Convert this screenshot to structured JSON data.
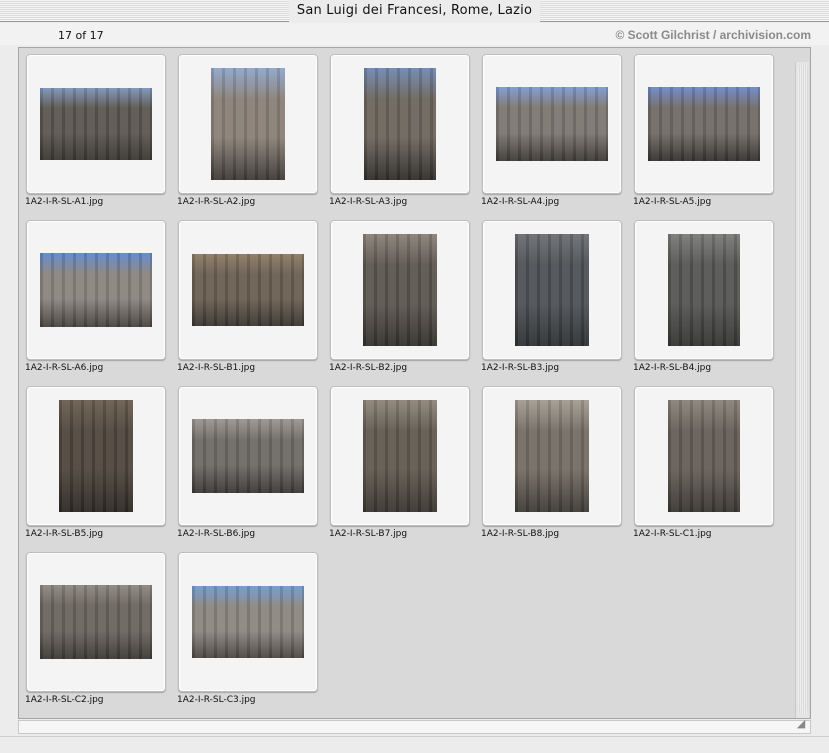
{
  "window": {
    "title": "San Luigi dei Francesi, Rome, Lazio"
  },
  "header": {
    "counter": "17 of 17",
    "copyright": "© Scott Gilchrist / archivision.com"
  },
  "thumbnails": [
    {
      "filename": "1A2-I-R-SL-A1.jpg",
      "icon": "church-facade-photo",
      "w": 112,
      "h": 72,
      "tone": [
        "#7d94b8",
        "#5b5650",
        "#3a3632"
      ]
    },
    {
      "filename": "1A2-I-R-SL-A2.jpg",
      "icon": "church-facade-photo",
      "w": 74,
      "h": 112,
      "tone": [
        "#8ea6c9",
        "#8a8076",
        "#3d3a36"
      ]
    },
    {
      "filename": "1A2-I-R-SL-A3.jpg",
      "icon": "church-facade-photo",
      "w": 72,
      "h": 112,
      "tone": [
        "#6f88b2",
        "#6d655c",
        "#2f2d2b"
      ]
    },
    {
      "filename": "1A2-I-R-SL-A4.jpg",
      "icon": "church-facade-photo",
      "w": 112,
      "h": 74,
      "tone": [
        "#7d9ad0",
        "#7c7670",
        "#3c3936"
      ]
    },
    {
      "filename": "1A2-I-R-SL-A5.jpg",
      "icon": "church-facade-photo",
      "w": 112,
      "h": 74,
      "tone": [
        "#6e88c8",
        "#716b66",
        "#34312f"
      ]
    },
    {
      "filename": "1A2-I-R-SL-A6.jpg",
      "icon": "church-facade-photo",
      "w": 112,
      "h": 74,
      "tone": [
        "#5f86cf",
        "#8a847e",
        "#46423e"
      ]
    },
    {
      "filename": "1A2-I-R-SL-B1.jpg",
      "icon": "church-facade-photo",
      "w": 112,
      "h": 72,
      "tone": [
        "#8b7a66",
        "#6b5f52",
        "#3a3530"
      ]
    },
    {
      "filename": "1A2-I-R-SL-B2.jpg",
      "icon": "church-facade-photo",
      "w": 74,
      "h": 112,
      "tone": [
        "#8a8178",
        "#5c5650",
        "#33302d"
      ]
    },
    {
      "filename": "1A2-I-R-SL-B3.jpg",
      "icon": "statue-niche-photo",
      "w": 74,
      "h": 112,
      "tone": [
        "#6b6e72",
        "#4e5155",
        "#2e3033"
      ]
    },
    {
      "filename": "1A2-I-R-SL-B4.jpg",
      "icon": "statue-niche-photo",
      "w": 72,
      "h": 112,
      "tone": [
        "#7a7a78",
        "#555553",
        "#343433"
      ]
    },
    {
      "filename": "1A2-I-R-SL-B5.jpg",
      "icon": "relief-medallion-photo",
      "w": 74,
      "h": 112,
      "tone": [
        "#6b5e50",
        "#4f463d",
        "#2d2823"
      ]
    },
    {
      "filename": "1A2-I-R-SL-B6.jpg",
      "icon": "relief-salamander-photo",
      "w": 112,
      "h": 74,
      "tone": [
        "#9a9590",
        "#6e6a66",
        "#3a3836"
      ]
    },
    {
      "filename": "1A2-I-R-SL-B7.jpg",
      "icon": "statue-niche-photo",
      "w": 74,
      "h": 112,
      "tone": [
        "#8e8578",
        "#615a50",
        "#39352f"
      ]
    },
    {
      "filename": "1A2-I-R-SL-B8.jpg",
      "icon": "statue-niche-photo",
      "w": 74,
      "h": 112,
      "tone": [
        "#a39c92",
        "#746d64",
        "#3e3a35"
      ]
    },
    {
      "filename": "1A2-I-R-SL-C1.jpg",
      "icon": "statue-niche-photo",
      "w": 72,
      "h": 112,
      "tone": [
        "#8a827a",
        "#655e57",
        "#3a3632"
      ]
    },
    {
      "filename": "1A2-I-R-SL-C2.jpg",
      "icon": "window-detail-photo",
      "w": 112,
      "h": 74,
      "tone": [
        "#8d8780",
        "#6a645e",
        "#3b3835"
      ]
    },
    {
      "filename": "1A2-I-R-SL-C3.jpg",
      "icon": "pediment-photo",
      "w": 112,
      "h": 72,
      "tone": [
        "#6f98d6",
        "#8c8680",
        "#4a4642"
      ]
    }
  ]
}
